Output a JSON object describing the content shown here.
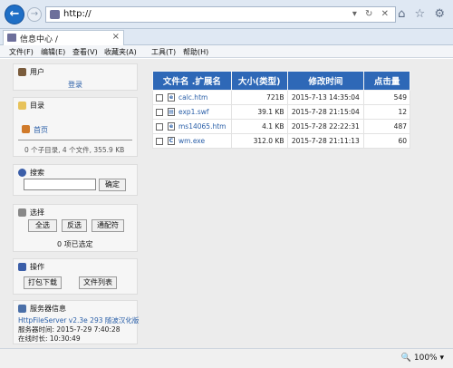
{
  "browser": {
    "url": "http://",
    "tab_title": "信息中心 /",
    "tab_close": "×",
    "menu": [
      "文件(F)",
      "编辑(E)",
      "查看(V)",
      "收藏夹(A)",
      "工具(T)",
      "帮助(H)"
    ],
    "url_tools": "▾ ↻ ✕",
    "top_icons": "⌂ ☆ ⚙"
  },
  "sidebar": {
    "user": {
      "title": "用户",
      "login": "登录"
    },
    "dir": {
      "title": "目录",
      "home": "首页",
      "summary": "0 个子目录, 4 个文件, 355.9 KB"
    },
    "search": {
      "title": "搜索",
      "value": "",
      "submit": "确定"
    },
    "select": {
      "title": "选择",
      "all": "全选",
      "invert": "反选",
      "wildcard": "通配符",
      "count": "0 项已选定"
    },
    "ops": {
      "title": "操作",
      "pack": "打包下载",
      "list": "文件列表"
    },
    "server": {
      "title": "服务器信息",
      "name": "HttpFileServer v2.3e 293 随波汉化版",
      "time": "服务器时间: 2015-7-29 7:40:28",
      "uptime": "在线时长: 10:30:49"
    }
  },
  "table": {
    "headers": [
      "文件名 .扩展名",
      "大小(类型)",
      "修改时间",
      "点击量"
    ],
    "rows": [
      {
        "name": "calc.htm",
        "icon": "e",
        "size": "721B",
        "mtime": "2015-7-13 14:35:04",
        "hits": "549"
      },
      {
        "name": "exp1.swf",
        "icon": "▤",
        "size": "39.1 KB",
        "mtime": "2015-7-28 21:15:04",
        "hits": "12"
      },
      {
        "name": "ms14065.htm",
        "icon": "e",
        "size": "4.1 KB",
        "mtime": "2015-7-28 22:22:31",
        "hits": "487"
      },
      {
        "name": "wm.exe",
        "icon": "C",
        "size": "312.0 KB",
        "mtime": "2015-7-28 21:11:13",
        "hits": "60"
      }
    ]
  },
  "status": {
    "zoom": "🔍 100%  ▾"
  },
  "colors": {
    "table_header": "#2e68b7",
    "link": "#2a5fa8",
    "back_button": "#1f6fc6"
  }
}
